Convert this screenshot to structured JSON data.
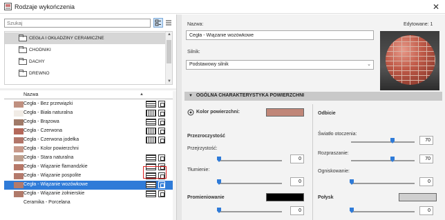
{
  "window": {
    "title": "Rodzaje wykończenia",
    "close_glyph": "✕"
  },
  "search": {
    "placeholder": "Szukaj",
    "value": "Szukaj"
  },
  "folders": [
    {
      "label": "CEGŁA I OKŁADZINY CERAMICZNE",
      "selected": true
    },
    {
      "label": "CHODNIKI",
      "selected": false
    },
    {
      "label": "DACHY",
      "selected": false
    },
    {
      "label": "DREWNO",
      "selected": false
    }
  ],
  "list": {
    "header": "Nazwa",
    "items": [
      {
        "name": "Cegła - Bez przewiązki",
        "color": "#c09080",
        "hatch": "a"
      },
      {
        "name": "Cegła - Biała naturalna",
        "color": "#f1ece6",
        "hatch": "b"
      },
      {
        "name": "Cegła - Brązowa",
        "color": "#a07a68",
        "hatch": "a"
      },
      {
        "name": "Cegła - Czerwona",
        "color": "#b4685a",
        "hatch": "b"
      },
      {
        "name": "Cegła - Czerwona jodełka",
        "color": "#b2766a",
        "hatch": "b"
      },
      {
        "name": "Cegła - Kolor powierzchni",
        "color": "#c8998a",
        "hatch": "none"
      },
      {
        "name": "Cegła - Stara naturalna",
        "color": "#bfa08f",
        "hatch": "a"
      },
      {
        "name": "Cegła - Wiązanie flamandzkie",
        "color": "#b77868",
        "hatch": "a"
      },
      {
        "name": "Cegła - Wiązanie pospolite",
        "color": "#b47a6c",
        "hatch": "a"
      },
      {
        "name": "Cegła - Wiązanie wozówkowe",
        "color": "#b47a6c",
        "hatch": "a",
        "selected": true
      },
      {
        "name": "Cegła - Wiązanie żołnierskie",
        "color": "#b07a6a",
        "hatch": "a"
      },
      {
        "name": "Ceramika - Porcelana",
        "color": "#ffffff",
        "hatch": "none"
      }
    ]
  },
  "details": {
    "name_label": "Nazwa:",
    "name_value": "Cegła - Wiązanie wozówkowe",
    "edited_label": "Edytowane: 1",
    "engine_label": "Silnik:",
    "engine_value": "Podstawowy silnik",
    "section_title": "OGÓLNA CHARAKTERYSTYKA POWIERZCHNI",
    "surface_color_label": "Kolor powierzchni:",
    "surface_color": "#c08678",
    "transparency_heading": "Przezroczystość",
    "transparency_label": "Przejrzystość:",
    "transparency_value": 0,
    "attenuation_label": "Tłumienie:",
    "attenuation_value": 0,
    "emission_label": "Promieniowanie",
    "emission_color": "#000000",
    "emission_value": 0,
    "reflection_heading": "Odbicie",
    "ambient_label": "Światło otoczenia:",
    "ambient_value": 70,
    "diffuse_label": "Rozpraszanie:",
    "diffuse_value": 70,
    "focus_label": "Ogniskowanie:",
    "focus_value": 0,
    "gloss_label": "Połysk",
    "gloss_color": "#cfcfcf",
    "gloss_value": 0
  }
}
